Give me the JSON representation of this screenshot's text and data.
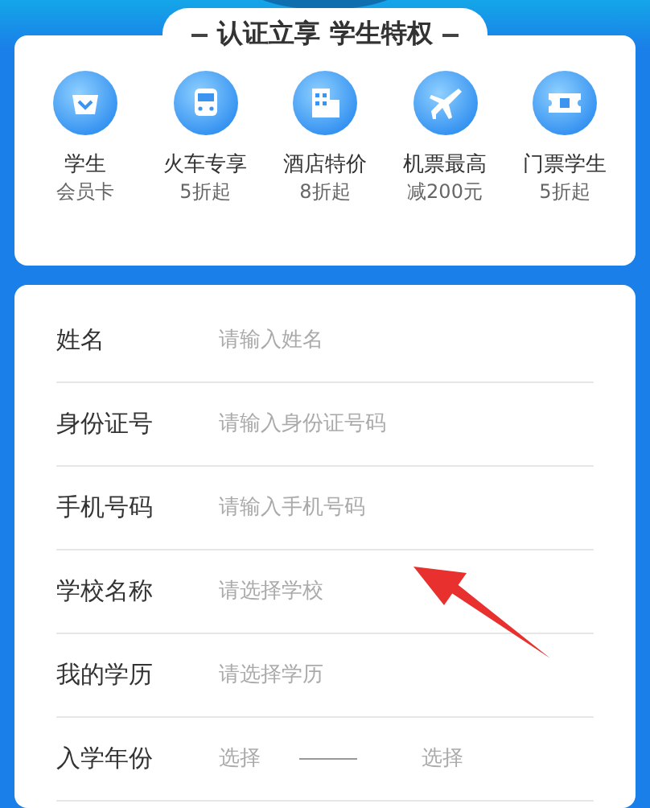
{
  "banner": {
    "title": "认证立享 学生特权"
  },
  "benefits": [
    {
      "kind": "card",
      "line1": "学生",
      "line2": "会员卡"
    },
    {
      "kind": "train",
      "line1": "火车专享",
      "line2": "5折起"
    },
    {
      "kind": "hotel",
      "line1": "酒店特价",
      "line2": "8折起"
    },
    {
      "kind": "plane",
      "line1": "机票最高",
      "line2": "减200元"
    },
    {
      "kind": "ticket",
      "line1": "门票学生",
      "line2": "5折起"
    }
  ],
  "form": [
    {
      "kind": "input",
      "label": "姓名",
      "placeholder": "请输入姓名"
    },
    {
      "kind": "input",
      "label": "身份证号",
      "placeholder": "请输入身份证号码"
    },
    {
      "kind": "input",
      "label": "手机号码",
      "placeholder": "请输入手机号码"
    },
    {
      "kind": "select",
      "label": "学校名称",
      "placeholder": "请选择学校"
    },
    {
      "kind": "select",
      "label": "我的学历",
      "placeholder": "请选择学历"
    },
    {
      "kind": "range",
      "label": "入学年份",
      "placeholder_from": "选择",
      "placeholder_to": "选择"
    }
  ]
}
